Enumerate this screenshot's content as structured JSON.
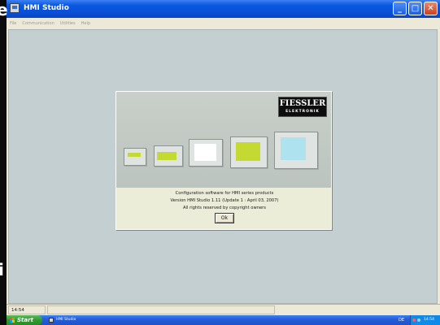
{
  "edge_chars": {
    "top": "e",
    "bottom": "i"
  },
  "window": {
    "title": "HMI Studio",
    "buttons": {
      "minimize": "_",
      "maximize": "□",
      "close": "✕"
    }
  },
  "menu": [
    "File",
    "Communication",
    "Utilities",
    "Help"
  ],
  "dialog": {
    "brand": {
      "name": "FIESSLER",
      "sub": "ELEKTRONIK"
    },
    "lines": [
      "Configuration software for HMI series products",
      "Version HMI Studio 1.11 (Update 1 : April 03, 2007)",
      "All rights reserved by copyright owners"
    ],
    "ok_label": "Ok"
  },
  "colors": {
    "panel_screen_lime": "#c4d932",
    "panel_screen_white": "#ffffff",
    "panel_screen_cyan": "#aee2ef"
  },
  "status": {
    "time": "14:54"
  },
  "taskbar": {
    "start_label": "Start",
    "task_label": "HMI Studio",
    "language": "DE",
    "clock": "14:54"
  }
}
